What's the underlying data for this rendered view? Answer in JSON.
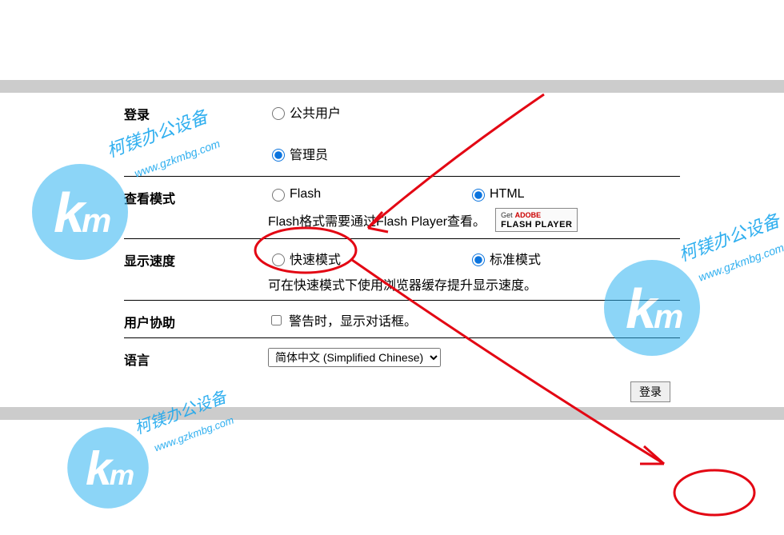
{
  "watermark": {
    "brand": "柯镁办公设备",
    "url": "www.gzkmbg.com"
  },
  "sections": {
    "login": {
      "label": "登录",
      "public_user": "公共用户",
      "admin": "管理员"
    },
    "view_mode": {
      "label": "查看模式",
      "flash": "Flash",
      "html": "HTML",
      "hint": "Flash格式需要通过Flash Player查看。",
      "badge_get": "Get",
      "badge_adobe": "ADOBE",
      "badge_fp": "FLASH PLAYER"
    },
    "speed": {
      "label": "显示速度",
      "fast": "快速模式",
      "standard": "标准模式",
      "hint": "可在快速模式下使用浏览器缓存提升显示速度。"
    },
    "assist": {
      "label": "用户协助",
      "checkbox": "警告时，显示对话框。"
    },
    "language": {
      "label": "语言",
      "selected": "简体中文 (Simplified Chinese)"
    }
  },
  "button": {
    "login": "登录"
  }
}
